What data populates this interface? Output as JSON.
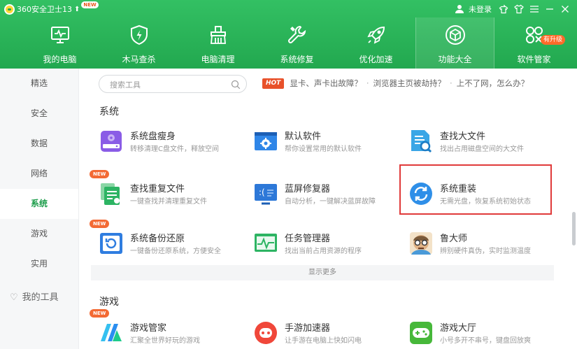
{
  "app": {
    "title": "360安全卫士13",
    "new_badge": "NEW"
  },
  "window": {
    "login": "未登录"
  },
  "tabs": [
    {
      "label": "我的电脑",
      "icon": "monitor-icon"
    },
    {
      "label": "木马查杀",
      "icon": "shield-bolt-icon"
    },
    {
      "label": "电脑清理",
      "icon": "broom-icon"
    },
    {
      "label": "系统修复",
      "icon": "wrench-icon"
    },
    {
      "label": "优化加速",
      "icon": "rocket-icon"
    },
    {
      "label": "功能大全",
      "icon": "cube-icon",
      "active": true
    },
    {
      "label": "软件管家",
      "icon": "apps-icon",
      "badge": "有升级"
    }
  ],
  "sidebar": {
    "items": [
      "精选",
      "安全",
      "数据",
      "网络",
      "系统",
      "游戏",
      "实用"
    ],
    "active": "系统",
    "tools_label": "我的工具"
  },
  "search": {
    "placeholder": "搜索工具"
  },
  "hot": {
    "badge": "HOT",
    "links": [
      "显卡、声卡出故障？",
      "浏览器主页被劫持？",
      "上不了网，怎么办？"
    ]
  },
  "sections": {
    "system": "系统",
    "games": "游戏"
  },
  "tools": [
    {
      "name": "系统盘瘦身",
      "desc": "转移清理C盘文件，释放空间",
      "icon": "disk-icon",
      "color": "#8a5ce6"
    },
    {
      "name": "默认软件",
      "desc": "帮你设置常用的默认软件",
      "icon": "default-software-icon",
      "color": "#2f86e8"
    },
    {
      "name": "查找大文件",
      "desc": "找出占用磁盘空间的大文件",
      "icon": "find-file-icon",
      "color": "#3aa6e6"
    },
    {
      "name": "查找重复文件",
      "desc": "一键查找并清理重复文件",
      "icon": "duplicate-file-icon",
      "color": "#2db463",
      "new": "NEW"
    },
    {
      "name": "蓝屏修复器",
      "desc": "自动分析，一键解决蓝屏故障",
      "icon": "bluescreen-icon",
      "color": "#2d78d8"
    },
    {
      "name": "系统重装",
      "desc": "无需光盘，恢复系统初始状态",
      "icon": "reinstall-icon",
      "color": "#2f8fe8"
    },
    {
      "name": "系统备份还原",
      "desc": "一键备份还原系统，方便安全",
      "icon": "backup-icon",
      "color": "#2f7de0",
      "new": "NEW"
    },
    {
      "name": "任务管理器",
      "desc": "找出当前占用资源的程序",
      "icon": "task-manager-icon",
      "color": "#2db463"
    },
    {
      "name": "鲁大师",
      "desc": "辨别硬件真伪，实时监测温度",
      "icon": "ludashi-icon",
      "color": "#c88a4a"
    }
  ],
  "show_more": "显示更多",
  "games": [
    {
      "name": "游戏管家",
      "desc": "汇聚全世界好玩的游戏",
      "icon": "game-manager-icon",
      "color": "#2a8ef0",
      "new": "NEW"
    },
    {
      "name": "手游加速器",
      "desc": "让手游在电脑上快如闪电",
      "icon": "mobile-game-icon",
      "color": "#f0473a"
    },
    {
      "name": "游戏大厅",
      "desc": "小号多开不串号，键盘回放爽",
      "icon": "gamepad-icon",
      "color": "#47b83a"
    }
  ]
}
